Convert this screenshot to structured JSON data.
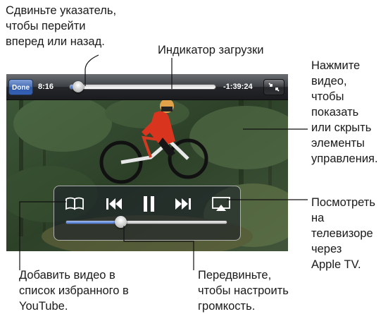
{
  "callouts": {
    "scrubber": [
      "Сдвиньте указатель,",
      "чтобы перейти",
      "вперед или назад."
    ],
    "loading": [
      "Индикатор загрузки"
    ],
    "tap_video": [
      "Нажмите",
      "видео,",
      "чтобы",
      "показать",
      "или скрыть",
      "элементы",
      "управления."
    ],
    "airplay": [
      "Посмотреть",
      "на",
      "телевизоре",
      "через",
      "Apple TV."
    ],
    "add_favorite": [
      "Добавить видео в",
      "список избранного в",
      "YouTube."
    ],
    "volume": [
      "Передвиньте,",
      "чтобы настроить",
      "громкость."
    ]
  },
  "player": {
    "done_label": "Done",
    "time_elapsed": "8:16",
    "time_remaining": "-1:39:24",
    "playback_progress": 0.06,
    "volume_level": 0.34
  },
  "icons": {
    "bookmark": "open-book-icon",
    "previous": "previous-track-icon",
    "pause": "pause-icon",
    "next": "next-track-icon",
    "airplay": "airplay-icon",
    "fullscreen": "exit-fullscreen-icon"
  },
  "colors": {
    "accent_blue": "#3d6cc9",
    "callout_line": "#111111"
  }
}
